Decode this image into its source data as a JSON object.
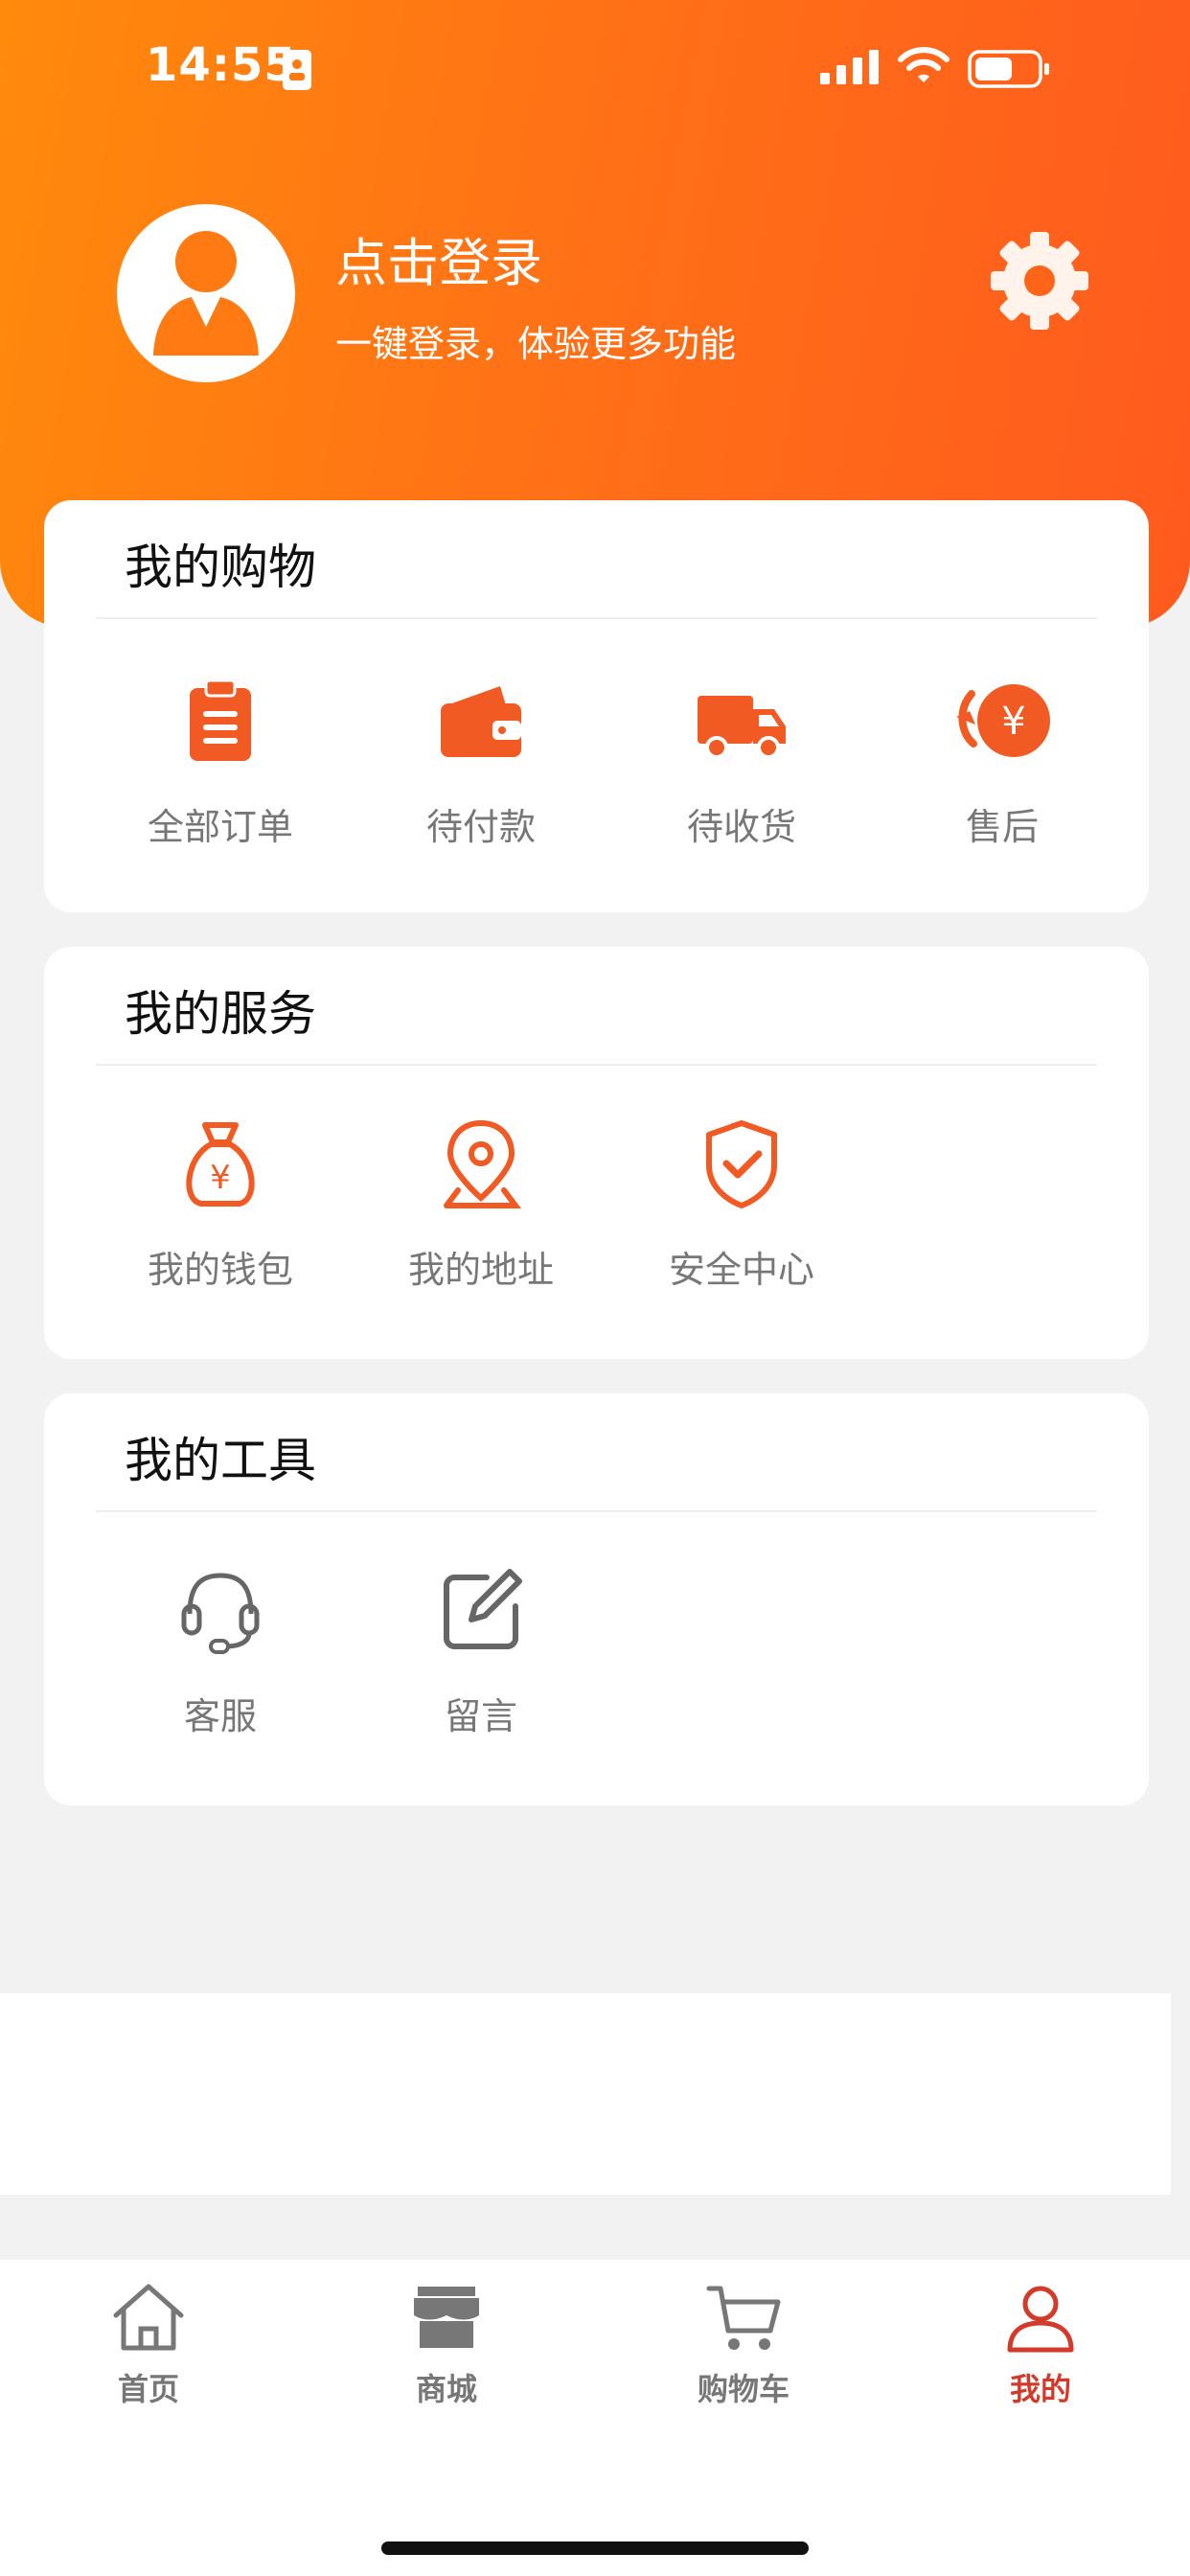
{
  "status_bar": {
    "time": "14:55"
  },
  "profile": {
    "title": "点击登录",
    "subtitle": "一键登录，体验更多功能",
    "settings_icon": "gear-icon"
  },
  "shopping": {
    "title": "我的购物",
    "items": [
      {
        "label": "全部订单",
        "icon": "clipboard-icon"
      },
      {
        "label": "待付款",
        "icon": "wallet-icon"
      },
      {
        "label": "待收货",
        "icon": "truck-icon"
      },
      {
        "label": "售后",
        "icon": "refund-icon"
      }
    ]
  },
  "services": {
    "title": "我的服务",
    "items": [
      {
        "label": "我的钱包",
        "icon": "money-bag-icon"
      },
      {
        "label": "我的地址",
        "icon": "location-pin-icon"
      },
      {
        "label": "安全中心",
        "icon": "shield-check-icon"
      }
    ]
  },
  "tools": {
    "title": "我的工具",
    "items": [
      {
        "label": "客服",
        "icon": "headset-icon"
      },
      {
        "label": "留言",
        "icon": "edit-icon"
      }
    ]
  },
  "tabbar": {
    "items": [
      {
        "label": "首页",
        "icon": "home-icon"
      },
      {
        "label": "商城",
        "icon": "store-icon"
      },
      {
        "label": "购物车",
        "icon": "cart-icon"
      },
      {
        "label": "我的",
        "icon": "user-icon",
        "active": true
      }
    ]
  },
  "colors": {
    "accent": "#ff5a1e",
    "header_start": "#ff8a0c",
    "active_tab": "#d23a2a",
    "background": "#f2f2f2"
  }
}
